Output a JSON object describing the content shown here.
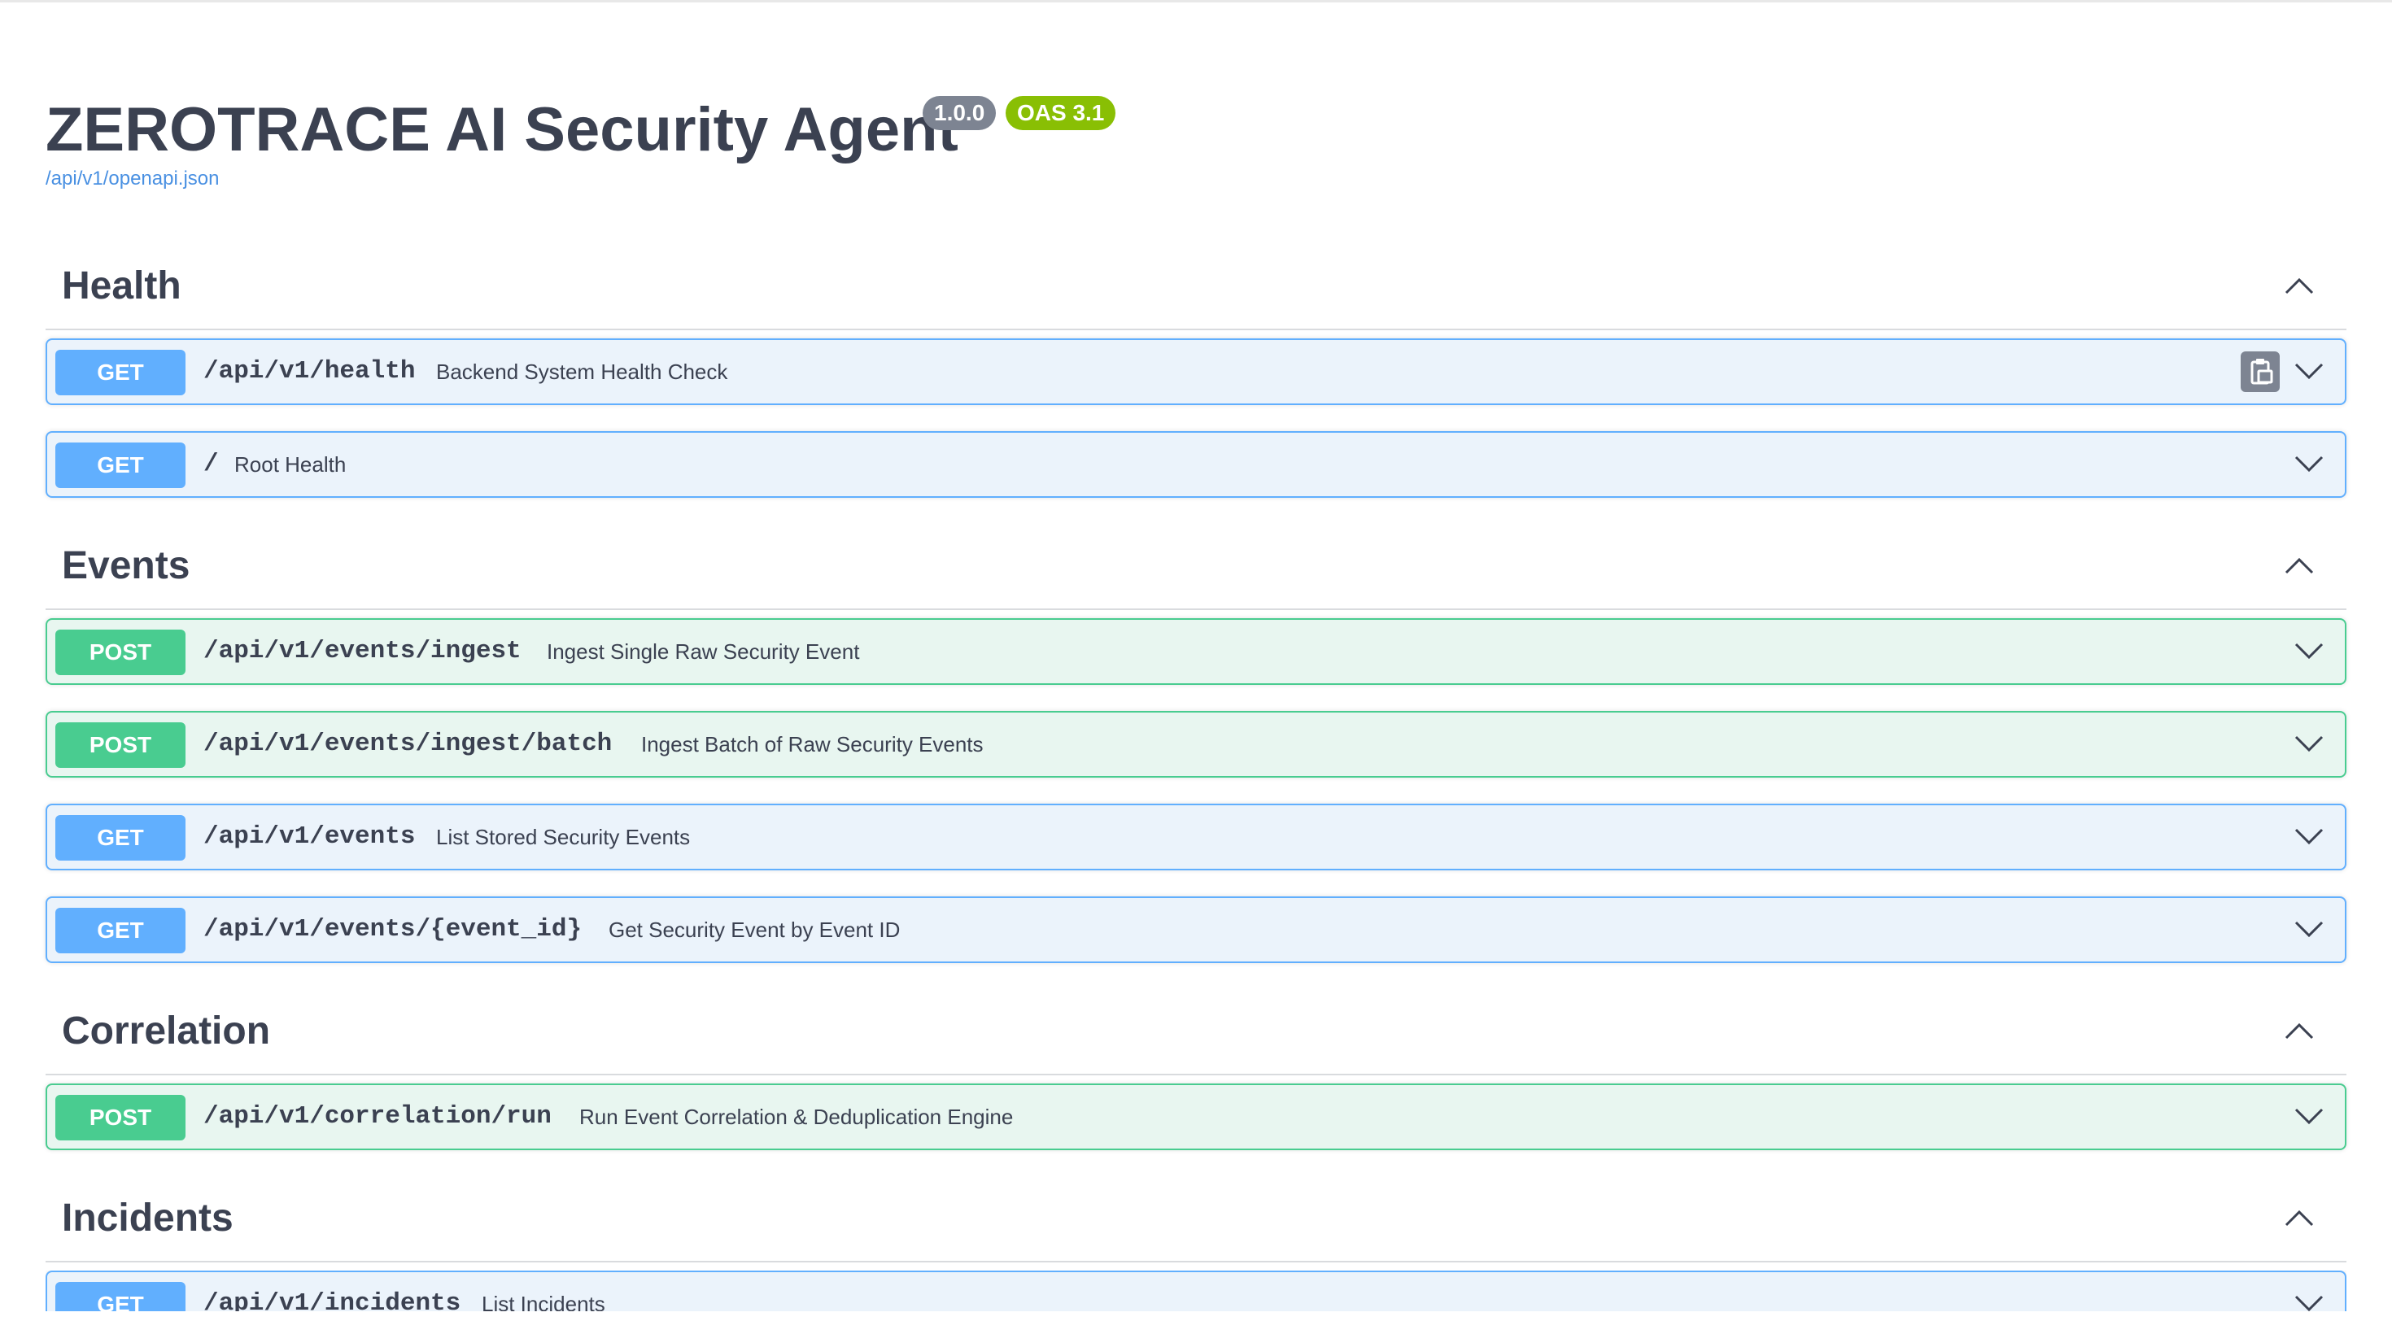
{
  "info": {
    "title": "ZEROTRACE AI Security Agent",
    "version_badge": "1.0.0",
    "oas_badge": "OAS 3.1",
    "spec_link": "/api/v1/openapi.json"
  },
  "colors": {
    "get": "#61affe",
    "post": "#49cc90",
    "text": "#3b4151",
    "link": "#4990e2",
    "version_badge": "#7d8492",
    "oas_badge": "#89bf04"
  },
  "icons": {
    "tag_toggle": "chevron-up-icon",
    "op_toggle": "chevron-down-icon",
    "copy": "clipboard-icon"
  },
  "tags": [
    {
      "name": "Health",
      "operations": [
        {
          "method": "GET",
          "path": "/api/v1/health",
          "summary": "Backend System Health Check"
        },
        {
          "method": "GET",
          "path": "/",
          "summary": "Root Health"
        }
      ]
    },
    {
      "name": "Events",
      "operations": [
        {
          "method": "POST",
          "path": "/api/v1/events/ingest",
          "summary": "Ingest Single Raw Security Event"
        },
        {
          "method": "POST",
          "path": "/api/v1/events/ingest/batch",
          "summary": "Ingest Batch of Raw Security Events"
        },
        {
          "method": "GET",
          "path": "/api/v1/events",
          "summary": "List Stored Security Events"
        },
        {
          "method": "GET",
          "path": "/api/v1/events/{event_id}",
          "summary": "Get Security Event by Event ID"
        }
      ]
    },
    {
      "name": "Correlation",
      "operations": [
        {
          "method": "POST",
          "path": "/api/v1/correlation/run",
          "summary": "Run Event Correlation & Deduplication Engine"
        }
      ]
    },
    {
      "name": "Incidents",
      "operations": [
        {
          "method": "GET",
          "path": "/api/v1/incidents",
          "summary": "List Incidents"
        }
      ]
    }
  ]
}
